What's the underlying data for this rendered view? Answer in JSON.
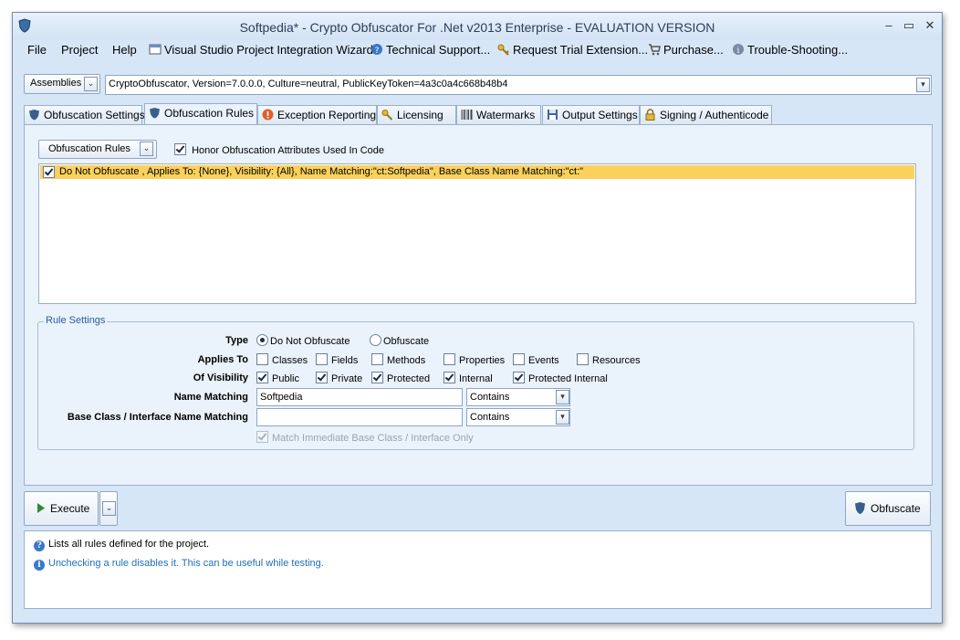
{
  "window": {
    "title": "Softpedia* - Crypto Obfuscator For .Net v2013 Enterprise - EVALUATION VERSION"
  },
  "menu": {
    "file": "File",
    "project": "Project",
    "help": "Help",
    "vs_wizard": "Visual Studio Project Integration Wizard",
    "tech_support": "Technical Support...",
    "trial_ext": "Request Trial Extension...",
    "purchase": "Purchase...",
    "troubleshoot": "Trouble-Shooting..."
  },
  "assemblies": {
    "button": "Assemblies",
    "selected": "CryptoObfuscator, Version=7.0.0.0, Culture=neutral, PublicKeyToken=4a3c0a4c668b48b4"
  },
  "tabs": [
    {
      "label": "Obfuscation Settings",
      "icon": "shield-icon"
    },
    {
      "label": "Obfuscation Rules",
      "icon": "shield-icon"
    },
    {
      "label": "Exception Reporting",
      "icon": "alert-icon"
    },
    {
      "label": "Licensing",
      "icon": "key-icon"
    },
    {
      "label": "Watermarks",
      "icon": "barcode-icon"
    },
    {
      "label": "Output Settings",
      "icon": "disk-icon"
    },
    {
      "label": "Signing / Authenticode",
      "icon": "lock-icon"
    }
  ],
  "rules": {
    "button": "Obfuscation Rules",
    "honor_attrs": "Honor Obfuscation Attributes Used In Code",
    "honor_checked": true,
    "items": [
      {
        "text": "Do Not Obfuscate , Applies To: {None}, Visibility: {All}, Name Matching:\"ct:Softpedia\", Base Class Name Matching:\"ct:\"",
        "checked": true
      }
    ]
  },
  "settings": {
    "group_label": "Rule Settings",
    "type_label": "Type",
    "type_do_not": "Do Not Obfuscate",
    "type_obfuscate": "Obfuscate",
    "applies_label": "Applies To",
    "applies": [
      "Classes",
      "Fields",
      "Methods",
      "Properties",
      "Events",
      "Resources"
    ],
    "visibility_label": "Of Visibility",
    "visibility": [
      "Public",
      "Private",
      "Protected",
      "Internal",
      "Protected Internal"
    ],
    "name_label": "Name Matching",
    "name_value": "Softpedia",
    "name_mode": "Contains",
    "base_label": "Base Class / Interface Name Matching",
    "base_value": "",
    "base_mode": "Contains",
    "match_immediate": "Match Immediate Base Class / Interface Only"
  },
  "actions": {
    "execute": "Execute",
    "obfuscate": "Obfuscate"
  },
  "info": {
    "line1": "Lists all rules defined for the project.",
    "line2": "Unchecking a rule disables it. This can be useful while testing."
  },
  "colors": {
    "highlight_row": "#fbd15c",
    "info_link": "#1f6fb8",
    "window_bg": "#d7e6f7"
  }
}
